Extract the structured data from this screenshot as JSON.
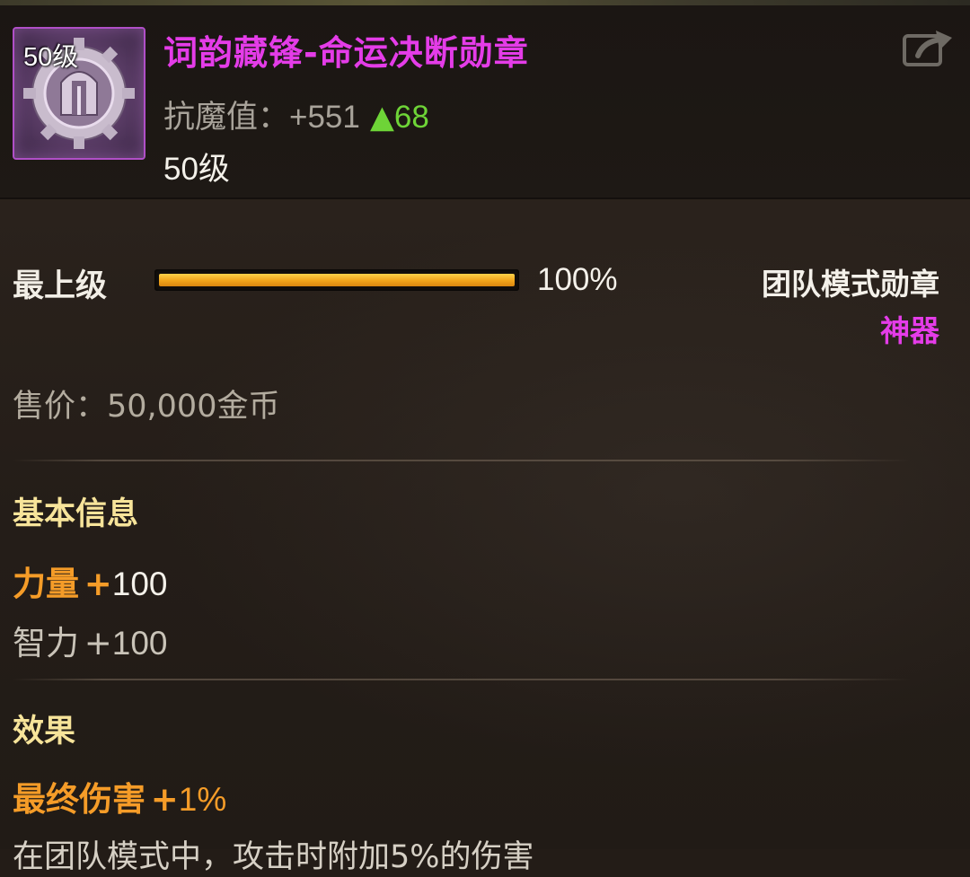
{
  "item": {
    "name": "词韵藏锋-命运决断勋章",
    "icon_name": "gear-medal-icon",
    "icon_level": "50级",
    "stat_label": "抗魔值：",
    "stat_value": "+551",
    "stat_increase_arrow": "▲",
    "stat_increase": "68",
    "level": "50级"
  },
  "grade": {
    "label": "最上级",
    "progress_percent": 100,
    "progress_text": "100%"
  },
  "category": "团队模式勋章",
  "rarity": "神器",
  "price": "售价：50,000金币",
  "basic_info": {
    "title": "基本信息",
    "attributes": [
      {
        "name": "力量",
        "sign": "+",
        "value": "100",
        "highlighted": true
      },
      {
        "name": "智力",
        "sign": "+",
        "value": "100",
        "highlighted": false
      }
    ]
  },
  "effects": {
    "title": "效果",
    "lines": [
      {
        "name": "最终伤害",
        "sign": "+",
        "value": "1%"
      }
    ],
    "description": "在团队模式中，攻击时附加5%的伤害"
  },
  "colors": {
    "legendary_name": "#e43ce8",
    "stat_up": "#6ed437",
    "section_title": "#f7e49a",
    "highlight_attr": "#f59c28",
    "progress_bar": "#f0a41a"
  }
}
